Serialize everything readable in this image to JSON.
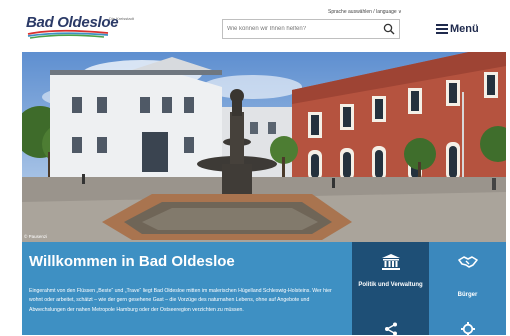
{
  "header": {
    "logo_text": "Bad Oldesloe",
    "logo_tagline": "Die Kreisstadt",
    "language_link": "Sprache auswählen / language ∨",
    "search_placeholder": "Wie können wir Ihnen helfen?",
    "menu_label": "Menü"
  },
  "hero": {
    "image_credit": "© Pausenzi"
  },
  "welcome": {
    "title": "Willkommen in Bad Oldesloe",
    "text": "Eingerahmt von den Flüssen „Beste“ und „Trave“ liegt Bad Oldesloe mitten im malerischen Hügelland Schleswig-Holsteins. Wer hier wohnt oder arbeitet, schätzt – wie der gern gesehene Gast – die Vorzüge des naturnahen Lebens, ohne auf Angebote und Abwechslungen der nahen Metropole Hamburg oder der Ostseeregion verzichten zu müssen."
  },
  "tiles": [
    {
      "label": "Politik und Verwaltung",
      "icon": "building-icon"
    },
    {
      "label": "Bürger",
      "icon": "handshake-icon"
    },
    {
      "label": "",
      "icon": "share-icon"
    },
    {
      "label": "",
      "icon": "gear-icon"
    }
  ],
  "colors": {
    "brand_dark": "#2b3a67",
    "welcome_blue": "#3e90c3",
    "tile_dark": "#1e4f76",
    "tile_mid": "#3b88bd"
  }
}
